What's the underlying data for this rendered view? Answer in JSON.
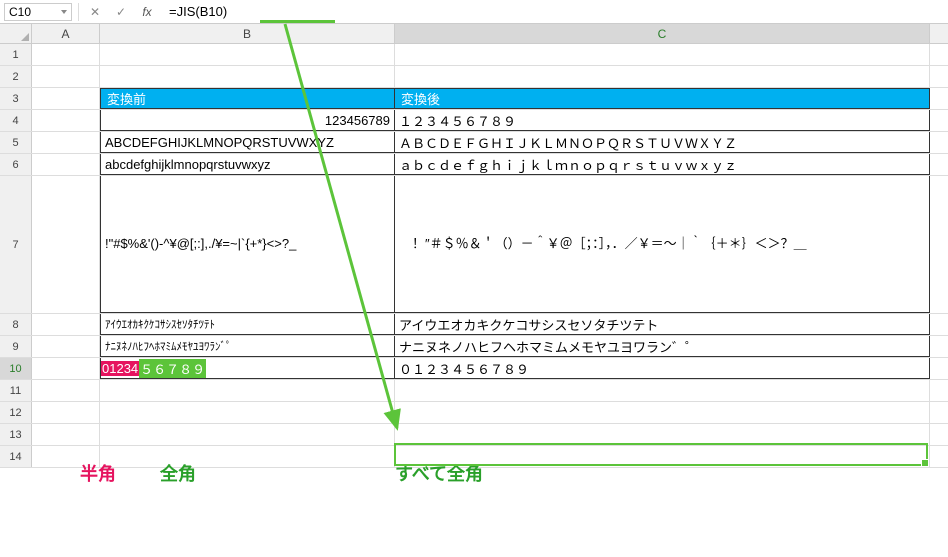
{
  "name_box": "C10",
  "formula": "=JIS(B10)",
  "col_headers": {
    "A": "A",
    "B": "B",
    "C": "C"
  },
  "headers": {
    "before": "変換前",
    "after": "変換後"
  },
  "rows": {
    "r4_b": "123456789",
    "r4_c": "１２３４５６７８９",
    "r5_b": "ABCDEFGHIJKLMNOPQRSTUVWXYZ",
    "r5_c": "ＡＢＣＤＥＦＧＨＩＪＫＬＭＮＯＰＱＲＳＴＵＶＷＸＹＺ",
    "r6_b": "abcdefghijklmnopqrstuvwxyz",
    "r6_c": "ａｂｃｄｅｆｇｈｉｊｋｌｍｎｏｐｑｒｓｔｕｖｗｘｙｚ",
    "r7_b": " !\"#$%&'()-^¥@[;:],./¥=~|`{+*}<>?_",
    "r7_c": "　！″＃＄％＆＇（）－＾￥＠［；：］，．／￥＝～｜｀｛＋＊｝＜＞？＿",
    "r8_b": "ｱｲｳｴｵｶｷｸｹｺｻｼｽｾｿﾀﾁﾂﾃﾄ",
    "r8_c": "アイウエオカキクケコサシスセソタチツテト",
    "r9_b": "ﾅﾆﾇﾈﾉﾊﾋﾌﾍﾎﾏﾐﾑﾒﾓﾔﾕﾖﾜﾗﾝﾞﾟ",
    "r9_c": "ナニヌネノハヒフヘホマミムメモヤユヨワラン゛゜",
    "r10_b_part1": "01234",
    "r10_b_part2": "５６７８９",
    "r10_c": "０１２３４５６７８９"
  },
  "annotations": {
    "hankaku": "半角",
    "zenkaku": "全角",
    "all_zenkaku": "すべて全角"
  }
}
